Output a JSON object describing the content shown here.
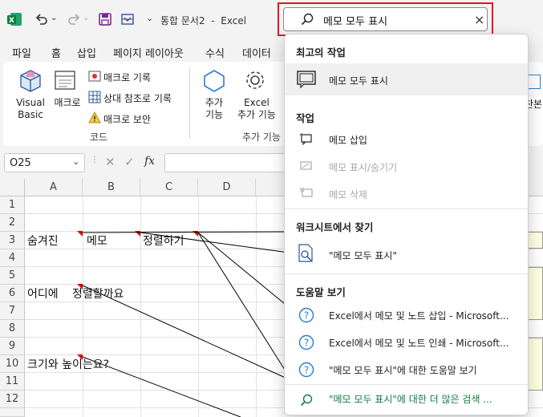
{
  "title": {
    "doc_name": "통합 문서2",
    "separator": "-",
    "app_name": "Excel"
  },
  "search": {
    "value": "메모 모두 표시"
  },
  "menu_tabs": [
    "파일",
    "홈",
    "삽입",
    "페이지 레이아웃",
    "수식",
    "데이터"
  ],
  "ribbon": {
    "visual_basic_line1": "Visual",
    "visual_basic_line2": "Basic",
    "macro": "매크로",
    "record_macro": "매크로 기록",
    "relative_ref": "상대 참조로 기록",
    "macro_security": "매크로 보안",
    "group_code": "코드",
    "addins_line1": "추가",
    "addins_line2": "기능",
    "excel_addins_line1": "Excel",
    "excel_addins_line2": "추가 기능",
    "group_addins": "추가 기능",
    "cut_label": "찬본"
  },
  "formula_bar": {
    "name_box": "O25",
    "fx": "fx"
  },
  "grid": {
    "columns": [
      "A",
      "B",
      "C",
      "D"
    ],
    "rows": [
      "1",
      "2",
      "3",
      "4",
      "5",
      "6",
      "7",
      "8",
      "9",
      "10",
      "11",
      "12"
    ],
    "cells": {
      "a3": "숨겨진",
      "b3": "메모",
      "c3": "정렬하기",
      "a6": "어디에",
      "b6": "정렬할까요",
      "a10": "크기와 높이는요?"
    }
  },
  "panel": {
    "recent_title": "최고의 작업",
    "recent_item": "메모 모두 표시",
    "actions_title": "작업",
    "insert_comment": "메모 삽입",
    "show_hide_comment": "메모 표시/숨기기",
    "delete_comment": "메모 삭제",
    "worksheet_title": "워크시트에서 찾기",
    "worksheet_item": "\"메모 모두 표시\"",
    "help_title": "도움말 보기",
    "help_1": "Excel에서 메모 및 노트 삽입 - Microsoft...",
    "help_2": "Excel에서 메모 및 노트 인쇄 - Microsoft...",
    "help_3": "\"메모 모두 표시\"에 대한 도움말 보기",
    "more_search": "\"메모 모두 표시\"에 대한 더 많은 검색 ..."
  },
  "colors": {
    "excel_green": "#107c41",
    "highlight_red": "#e81123",
    "link_green": "#107c41"
  }
}
